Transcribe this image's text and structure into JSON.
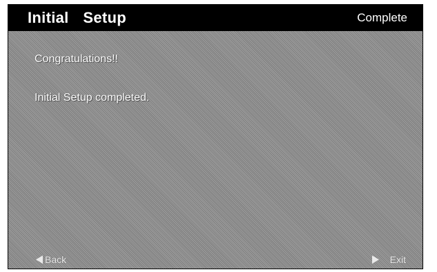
{
  "header": {
    "title": "Initial  Setup",
    "step": "Complete"
  },
  "content": {
    "line1": "Congratulations!!",
    "line2": "Initial Setup completed."
  },
  "footer": {
    "back_label": "Back",
    "back_icon": "triangle-left-icon",
    "exit_label": "Exit",
    "exit_icon": "triangle-right-icon"
  }
}
